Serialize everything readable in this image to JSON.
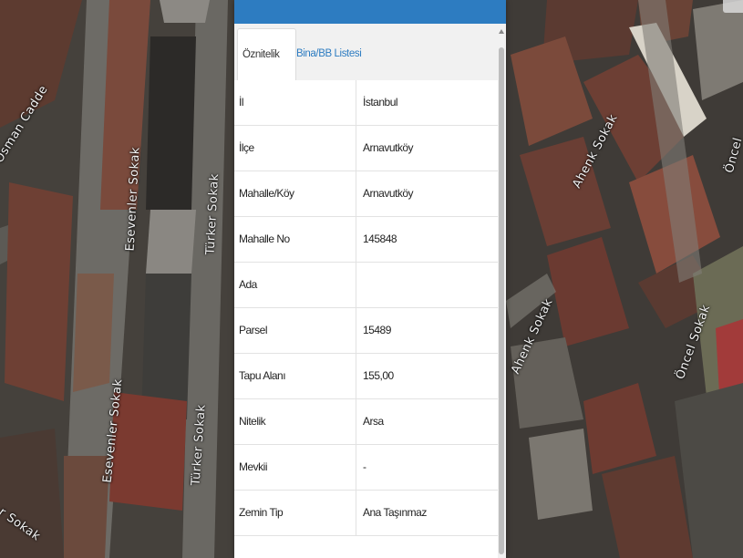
{
  "map": {
    "streets": [
      {
        "id": "osman-cadde",
        "text": "Osman Cadde"
      },
      {
        "id": "esevenler-top",
        "text": "Esevenler Sokak"
      },
      {
        "id": "turker-top",
        "text": "Türker Sokak"
      },
      {
        "id": "esevenler-bottom",
        "text": "Esevenler Sokak"
      },
      {
        "id": "turker-bottom",
        "text": "Türker Sokak"
      },
      {
        "id": "sokak-left",
        "text": "r Sokak"
      },
      {
        "id": "ahenk-top",
        "text": "Ahenk Sokak"
      },
      {
        "id": "ahenk-bottom",
        "text": "Ahenk Sokak"
      },
      {
        "id": "oncel-middle",
        "text": "Öncel Sokak"
      },
      {
        "id": "oncel-top",
        "text": "Öncel"
      }
    ]
  },
  "panel": {
    "tabs": [
      {
        "label": "Öznitelik Bilgisi",
        "active": true
      },
      {
        "label": "Bina/BB Listesi",
        "active": false
      }
    ],
    "rows": [
      {
        "label": "İl",
        "value": "İstanbul"
      },
      {
        "label": "İlçe",
        "value": "Arnavutköy"
      },
      {
        "label": "Mahalle/Köy",
        "value": "Arnavutköy"
      },
      {
        "label": "Mahalle No",
        "value": "145848"
      },
      {
        "label": "Ada",
        "value": ""
      },
      {
        "label": "Parsel",
        "value": "15489"
      },
      {
        "label": "Tapu Alanı",
        "value": "155,00"
      },
      {
        "label": "Nitelik",
        "value": "Arsa"
      },
      {
        "label": "Mevkii",
        "value": "-"
      },
      {
        "label": "Zemin Tip",
        "value": "Ana Taşınmaz"
      }
    ]
  },
  "colors": {
    "header": "#2d7cc1",
    "tab_link": "#2d7cc1"
  }
}
